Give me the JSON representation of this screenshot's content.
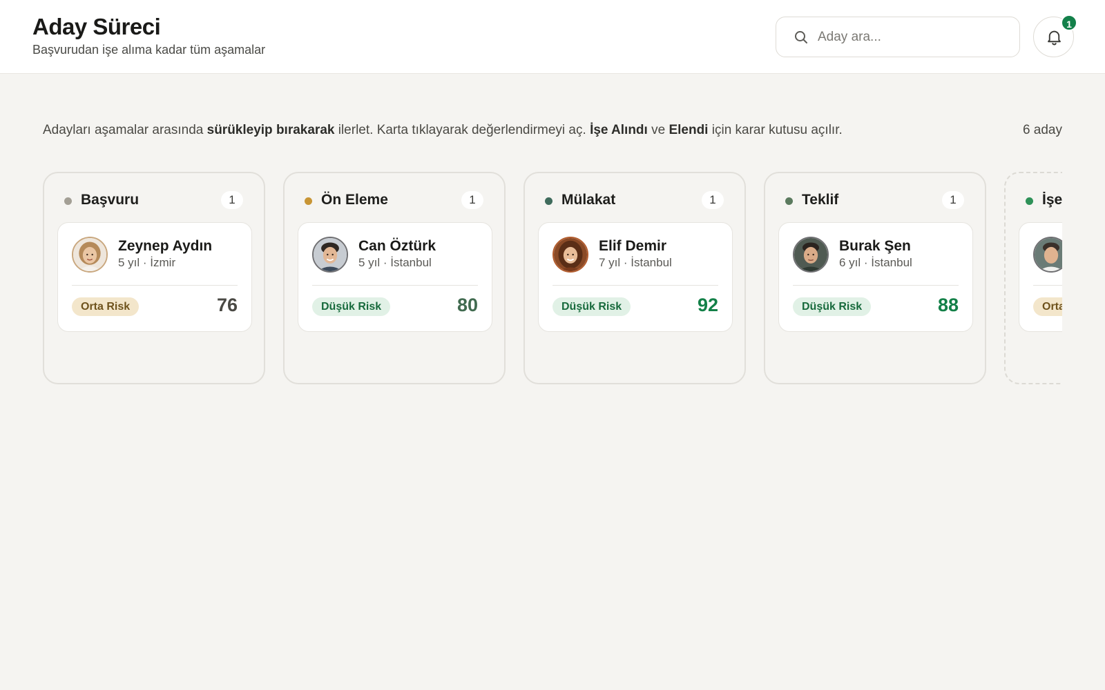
{
  "header": {
    "title": "Aday Süreci",
    "subtitle": "Başvurudan işe alıma kadar tüm aşamalar",
    "search_placeholder": "Aday ara...",
    "notification_count": "1"
  },
  "instructions": {
    "part1": "Adayları aşamalar arasında ",
    "bold1": "sürükleyip bırakarak",
    "part2": " ilerlet. Karta tıklayarak değerlendirmeyi aç. ",
    "bold2": "İşe Alındı",
    "part3": " ve ",
    "bold3": "Elendi",
    "part4": " için karar kutusu açılır."
  },
  "candidate_count": "6 aday",
  "columns": [
    {
      "title": "Başvuru",
      "count": "1",
      "dot_color": "#a39f95",
      "card": {
        "name": "Zeynep Aydın",
        "meta": "5 yıl · İzmir",
        "risk": "Orta Risk",
        "risk_level": "medium",
        "score": "76"
      }
    },
    {
      "title": "Ön Eleme",
      "count": "1",
      "dot_color": "#c89535",
      "card": {
        "name": "Can Öztürk",
        "meta": "5 yıl · İstanbul",
        "risk": "Düşük Risk",
        "risk_level": "low",
        "score": "80"
      }
    },
    {
      "title": "Mülakat",
      "count": "1",
      "dot_color": "#3f6b5c",
      "card": {
        "name": "Elif Demir",
        "meta": "7 yıl · İstanbul",
        "risk": "Düşük Risk",
        "risk_level": "low",
        "score": "92"
      }
    },
    {
      "title": "Teklif",
      "count": "1",
      "dot_color": "#5b7a5e",
      "card": {
        "name": "Burak Şen",
        "meta": "6 yıl · İstanbul",
        "risk": "Düşük Risk",
        "risk_level": "low",
        "score": "88"
      }
    },
    {
      "title": "İşe",
      "count": "",
      "dot_color": "#2e9158",
      "card": {
        "name": "",
        "meta": "",
        "risk": "Orta",
        "risk_level": "medium",
        "score": ""
      }
    }
  ],
  "colors": {
    "accent_green": "#13804a",
    "risk_low_bg": "#e1f1e6",
    "risk_mid_bg": "#f3e6cb"
  },
  "icons": {
    "search": "search-icon",
    "notifications": "bell-icon"
  }
}
